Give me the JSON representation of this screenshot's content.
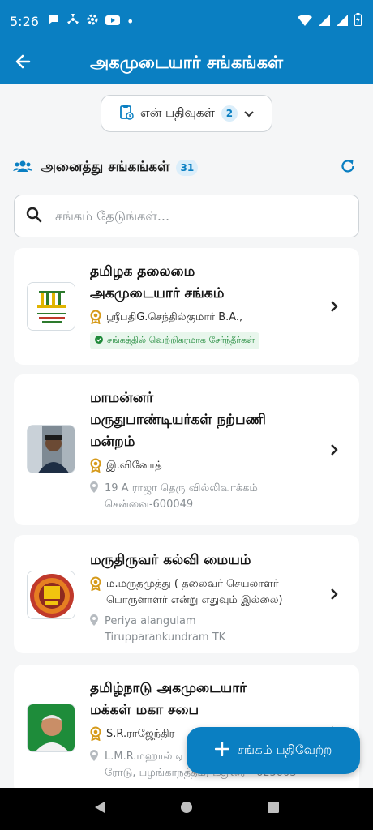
{
  "status_bar": {
    "time": "5:26",
    "dot": "•"
  },
  "app_bar": {
    "title": "அகமுடையார் சங்கங்கள்"
  },
  "my_posts": {
    "label": "என் பதிவுகள்",
    "count": "2"
  },
  "section": {
    "title": "அனைத்து சங்கங்கள்",
    "count": "31"
  },
  "search": {
    "placeholder": "சங்கம் தேடுங்கள்..."
  },
  "cards": [
    {
      "title_line1": "தமிழக தலைமை",
      "title_line2": "அகமுடையார் சங்கம்",
      "leader": "ஸ்ரீபதிG.செந்தில்குமார் B.A.,",
      "status": "சங்கத்தில் வெற்றிகரமாக சேர்ந்தீர்கள்"
    },
    {
      "title_line1": "மாமன்னர்",
      "title_line2": "மருதுபாண்டியர்கள் நற்பணி",
      "title_line3": "மன்றம்",
      "leader": "இ.வினோத்",
      "address_line1": "19 A ராஜா தெரு வில்லிவாக்கம்",
      "address_line2": "சென்னை-600049"
    },
    {
      "title_line1": "மருதிருவர் கல்வி மையம்",
      "leader_line1": "ம.மருதமுத்து ( தலைவர் செயலாளர்",
      "leader_line2": "பொருளாளர் என்று எதுவும் இல்லை)",
      "address_line1": "Periya alangulam",
      "address_line2": "Tirupparankundram TK"
    },
    {
      "title_line1": "தமிழ்நாடு அகமுடையார்",
      "title_line2": "மக்கள் மகா சபை",
      "leader": "S.R.ராஜேந்திர",
      "address_line1": "L.M.R.மஹால் ஏ",
      "address_line2": "ரோடு, பழங்காநத்தம், மதுரை - 625003"
    }
  ],
  "fab": {
    "label": "சங்கம் பதிவேற்ற"
  },
  "colors": {
    "primary": "#0a7fc2",
    "gold": "#d69a1a",
    "success": "#1f8a3a"
  },
  "icons": {
    "back": "arrow-left-icon",
    "clipboard": "clipboard-icon",
    "chevron_down": "chevron-down-icon",
    "group": "group-icon",
    "refresh": "refresh-icon",
    "search": "search-icon",
    "award": "award-icon",
    "location": "location-pin-icon",
    "check": "check-circle-icon",
    "chevron_right": "chevron-right-icon",
    "plus": "plus-icon"
  }
}
